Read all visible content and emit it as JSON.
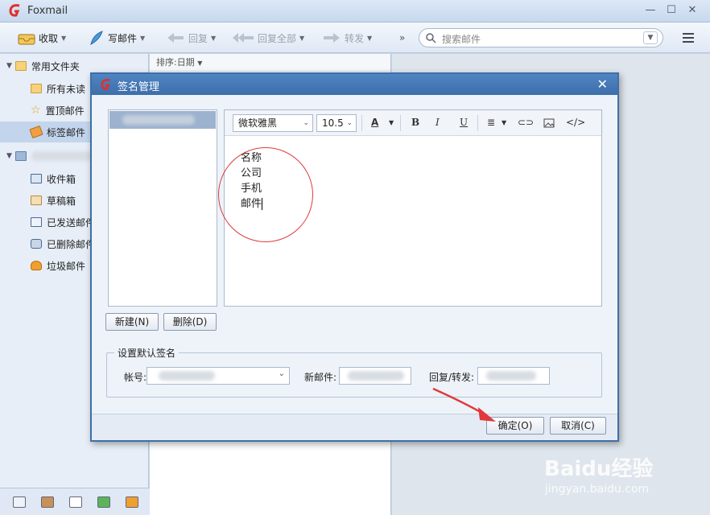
{
  "app": {
    "title": "Foxmail"
  },
  "toolbar": {
    "receive": "收取",
    "compose": "写邮件",
    "reply": "回复",
    "reply_all": "回复全部",
    "forward": "转发",
    "more": "»",
    "search_placeholder": "搜索邮件"
  },
  "sidebar": {
    "common_folder": "常用文件夹",
    "items": [
      {
        "label": "所有未读"
      },
      {
        "label": "置顶邮件"
      },
      {
        "label": "标签邮件"
      }
    ],
    "account_items": [
      {
        "label": "收件箱"
      },
      {
        "label": "草稿箱"
      },
      {
        "label": "已发送邮件"
      },
      {
        "label": "已删除邮件"
      },
      {
        "label": "垃圾邮件"
      }
    ]
  },
  "list": {
    "sort_label": "排序:日期"
  },
  "dialog": {
    "title": "签名管理",
    "font_name": "微软雅黑",
    "font_size": "10.5",
    "signature_lines": [
      "名称",
      "公司",
      "手机",
      "邮件"
    ],
    "new_button": "新建(N)",
    "delete_button": "删除(D)",
    "default_group": "设置默认签名",
    "account_label": "帐号:",
    "new_mail_label": "新邮件:",
    "reply_label": "回复/转发:",
    "ok_button": "确定(O)",
    "cancel_button": "取消(C)"
  },
  "watermark": {
    "brand": "Baidu经验",
    "url": "jingyan.baidu.com"
  },
  "colors": {
    "accent": "#3d6eab",
    "annotation": "#e03a3a"
  }
}
